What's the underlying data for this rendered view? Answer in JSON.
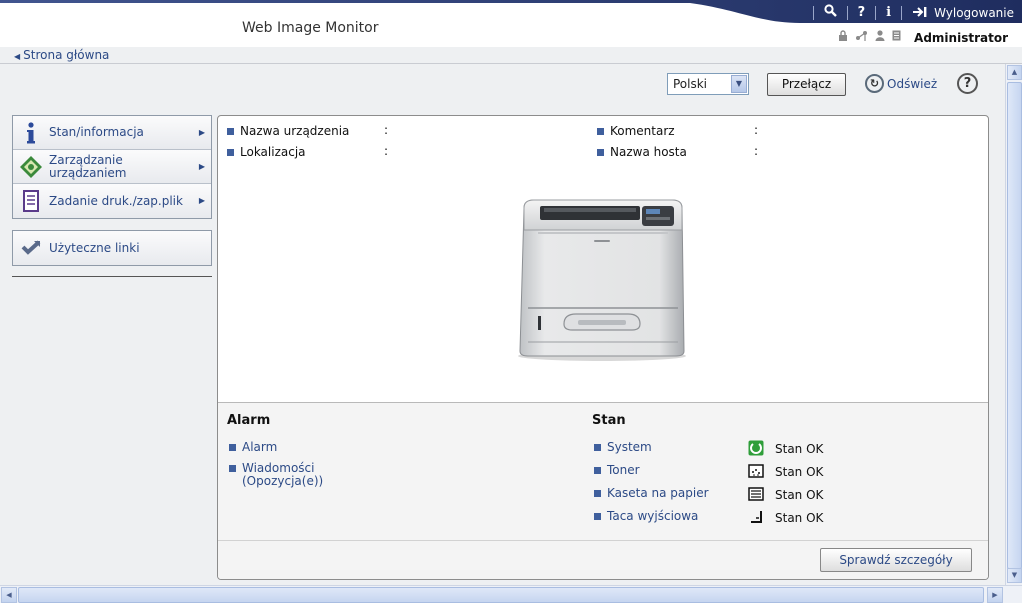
{
  "header": {
    "app_title": "Web Image Monitor",
    "logout_label": "Wylogowanie",
    "user_label": "Administrator",
    "icons": [
      "search-icon",
      "help-icon",
      "info-icon",
      "logout-icon",
      "lock-icon",
      "network-icon",
      "user-icon",
      "document-icon"
    ]
  },
  "breadcrumb": {
    "home_label": "Strona główna"
  },
  "controls": {
    "language_selected": "Polski",
    "switch_label": "Przełącz",
    "refresh_label": "Odśwież",
    "help_label": "?"
  },
  "menu": {
    "items": [
      {
        "label": "Stan/informacja",
        "icon": "info-icon"
      },
      {
        "label": "Zarządzanie urządzaniem",
        "icon": "device-management-icon"
      },
      {
        "label": "Zadanie druk./zap.plik",
        "icon": "print-job-icon"
      }
    ],
    "links": {
      "label": "Użyteczne linki",
      "icon": "links-icon"
    }
  },
  "device": {
    "name_label": "Nazwa urządzenia",
    "location_label": "Lokalizacja",
    "comment_label": "Komentarz",
    "hostname_label": "Nazwa hosta",
    "colon": ":"
  },
  "alarm": {
    "title": "Alarm",
    "links": [
      "Alarm",
      "Wiadomości (Opozycja(e))"
    ]
  },
  "status": {
    "title": "Stan",
    "items": [
      {
        "label": "System",
        "value": "Stan OK",
        "icon": "system-ok-icon"
      },
      {
        "label": "Toner",
        "value": "Stan OK",
        "icon": "toner-icon"
      },
      {
        "label": "Kaseta na papier",
        "value": "Stan OK",
        "icon": "paper-tray-icon"
      },
      {
        "label": "Taca wyjściowa",
        "value": "Stan OK",
        "icon": "output-tray-icon"
      }
    ]
  },
  "details_button": "Sprawdź szczegóły",
  "colors": {
    "accent": "#2c4a86",
    "header_dark": "#25356a",
    "bullet": "#3f5f9d"
  }
}
